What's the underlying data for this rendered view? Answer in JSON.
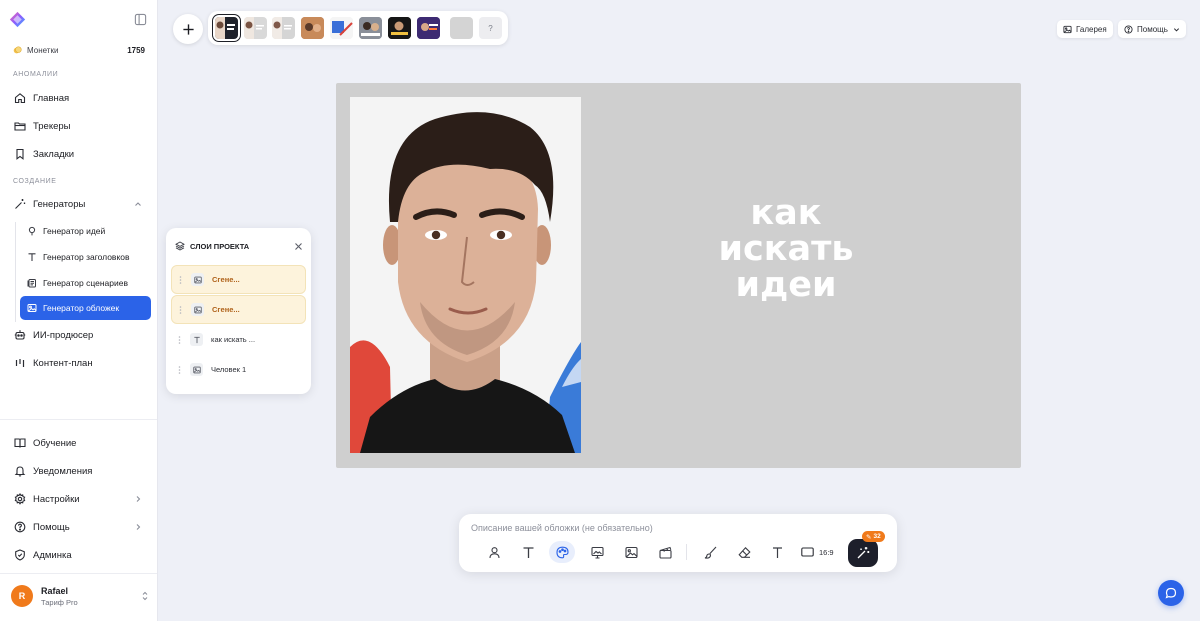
{
  "sidebar": {
    "coins": {
      "label": "Монетки",
      "value": "1759"
    },
    "sections": {
      "anomalies": "АНОМАЛИИ",
      "creation": "СОЗДАНИЕ"
    },
    "items": {
      "home": "Главная",
      "trackers": "Трекеры",
      "bookmarks": "Закладки",
      "generators": "Генераторы",
      "ai_producer": "ИИ-продюсер",
      "content_plan": "Контент-план",
      "learning": "Обучение",
      "notifications": "Уведомления",
      "settings": "Настройки",
      "help": "Помощь",
      "admin": "Админка"
    },
    "generators": {
      "ideas": "Генератор идей",
      "titles": "Генератор заголовков",
      "scripts": "Генератор сценариев",
      "covers": "Генератор обложек"
    },
    "user": {
      "initial": "R",
      "name": "Rafael",
      "plan": "Тариф Pro"
    }
  },
  "topbar": {
    "gallery": "Галерея",
    "help": "Помощь",
    "help_thumb": "?"
  },
  "canvas": {
    "cover_text": [
      "как",
      "искать",
      "идеи"
    ]
  },
  "layers": {
    "title": "СЛОИ ПРОЕКТА",
    "items": [
      {
        "label": "Сгене..."
      },
      {
        "label": "Сгене..."
      },
      {
        "label": "как искать ..."
      },
      {
        "label": "Человек 1"
      }
    ]
  },
  "composer": {
    "placeholder": "Описание вашей обложки (не обязательно)",
    "ratio": "16:9",
    "cost": "32"
  },
  "colors": {
    "accent": "#2b63e8",
    "badge": "#f07a1b",
    "canvas_bg": "#cfcfcf"
  }
}
